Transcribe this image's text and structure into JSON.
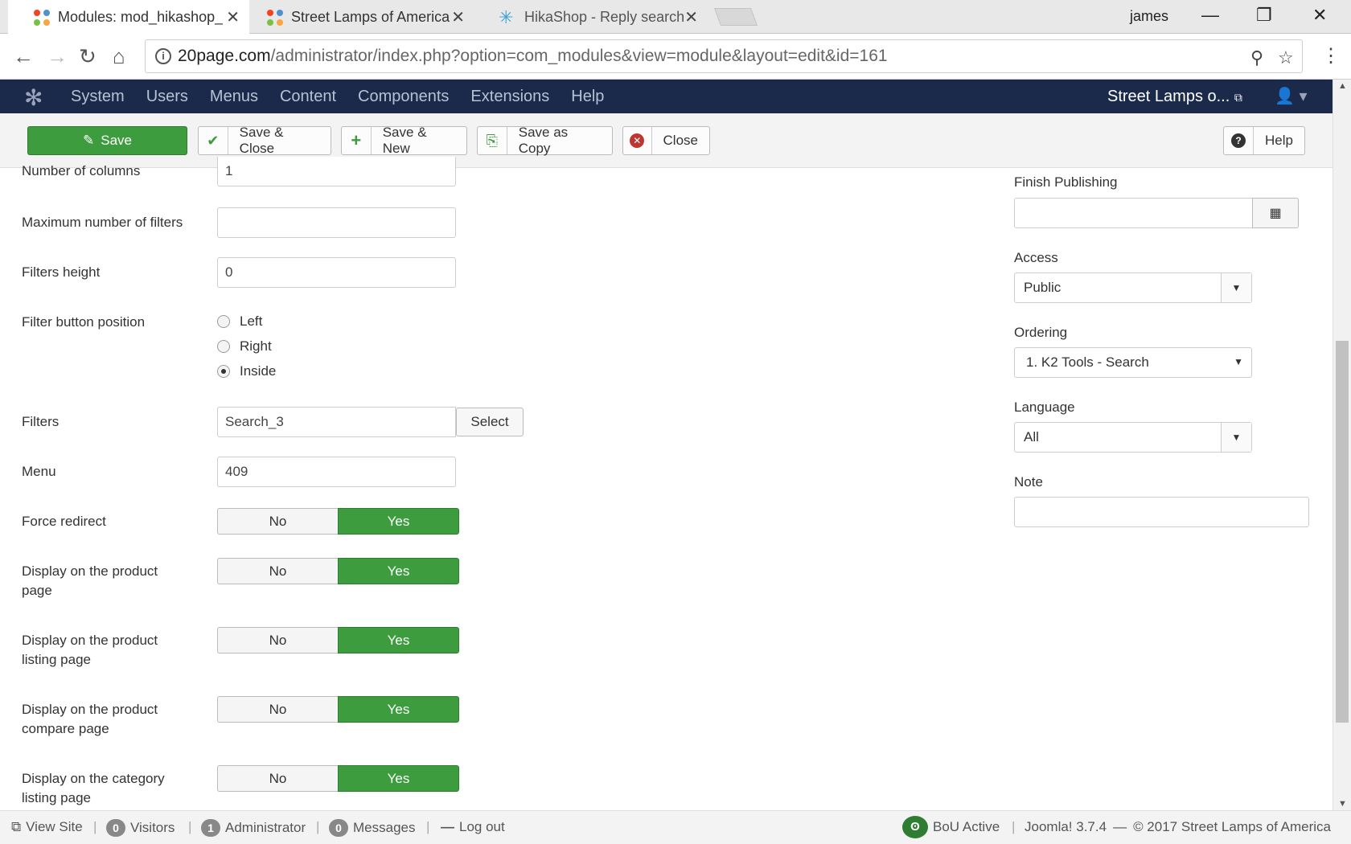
{
  "browser": {
    "tabs": [
      {
        "label": "Modules: mod_hikashop_",
        "icon": "joomla-icon",
        "active": true
      },
      {
        "label": "Street Lamps of America",
        "icon": "joomla-icon",
        "active": false
      },
      {
        "label": "HikaShop - Reply search",
        "icon": "hikashop-icon",
        "active": false
      }
    ],
    "profile_name": "james",
    "url_host": "20page.com",
    "url_path": "/administrator/index.php?option=com_modules&view=module&layout=edit&id=161"
  },
  "joomla_nav": {
    "items": [
      "System",
      "Users",
      "Menus",
      "Content",
      "Components",
      "Extensions",
      "Help"
    ],
    "site_name": "Street Lamps o..."
  },
  "toolbar": {
    "save": "Save",
    "save_close": "Save & Close",
    "save_new": "Save & New",
    "save_copy": "Save as Copy",
    "close": "Close",
    "help": "Help"
  },
  "form": {
    "number_of_columns": {
      "label": "Number of columns",
      "value": "1"
    },
    "max_filters": {
      "label": "Maximum number of filters",
      "value": ""
    },
    "filters_height": {
      "label": "Filters height",
      "value": "0"
    },
    "filter_button_position": {
      "label": "Filter button position",
      "options": [
        "Left",
        "Right",
        "Inside"
      ],
      "selected": "Inside"
    },
    "filters": {
      "label": "Filters",
      "value": "Search_3",
      "select_label": "Select"
    },
    "menu": {
      "label": "Menu",
      "value": "409"
    },
    "toggles": [
      {
        "label": "Force redirect",
        "no": "No",
        "yes": "Yes",
        "value": "Yes"
      },
      {
        "label": "Display on the product page",
        "no": "No",
        "yes": "Yes",
        "value": "Yes"
      },
      {
        "label": "Display on the product listing page",
        "no": "No",
        "yes": "Yes",
        "value": "Yes"
      },
      {
        "label": "Display on the product compare page",
        "no": "No",
        "yes": "Yes",
        "value": "Yes"
      },
      {
        "label": "Display on the category listing page",
        "no": "No",
        "yes": "Yes",
        "value": "Yes"
      }
    ]
  },
  "sidebar": {
    "finish_publishing": {
      "label": "Finish Publishing",
      "value": ""
    },
    "access": {
      "label": "Access",
      "value": "Public"
    },
    "ordering": {
      "label": "Ordering",
      "value": "1. K2 Tools - Search"
    },
    "language": {
      "label": "Language",
      "value": "All"
    },
    "note": {
      "label": "Note",
      "value": ""
    }
  },
  "statusbar": {
    "view_site": "View Site",
    "visitors_count": "0",
    "visitors_label": "Visitors",
    "admin_count": "1",
    "admin_label": "Administrator",
    "messages_count": "0",
    "messages_label": "Messages",
    "logout": "Log out",
    "bou_status": "BoU Active",
    "version": "Joomla! 3.7.4",
    "dash": "—",
    "copyright": "© 2017 Street Lamps of America"
  },
  "colors": {
    "nav_bg": "#1b2a4a",
    "toggle_yes": "#3d9c3e",
    "save_button": "#3d9c3e"
  }
}
